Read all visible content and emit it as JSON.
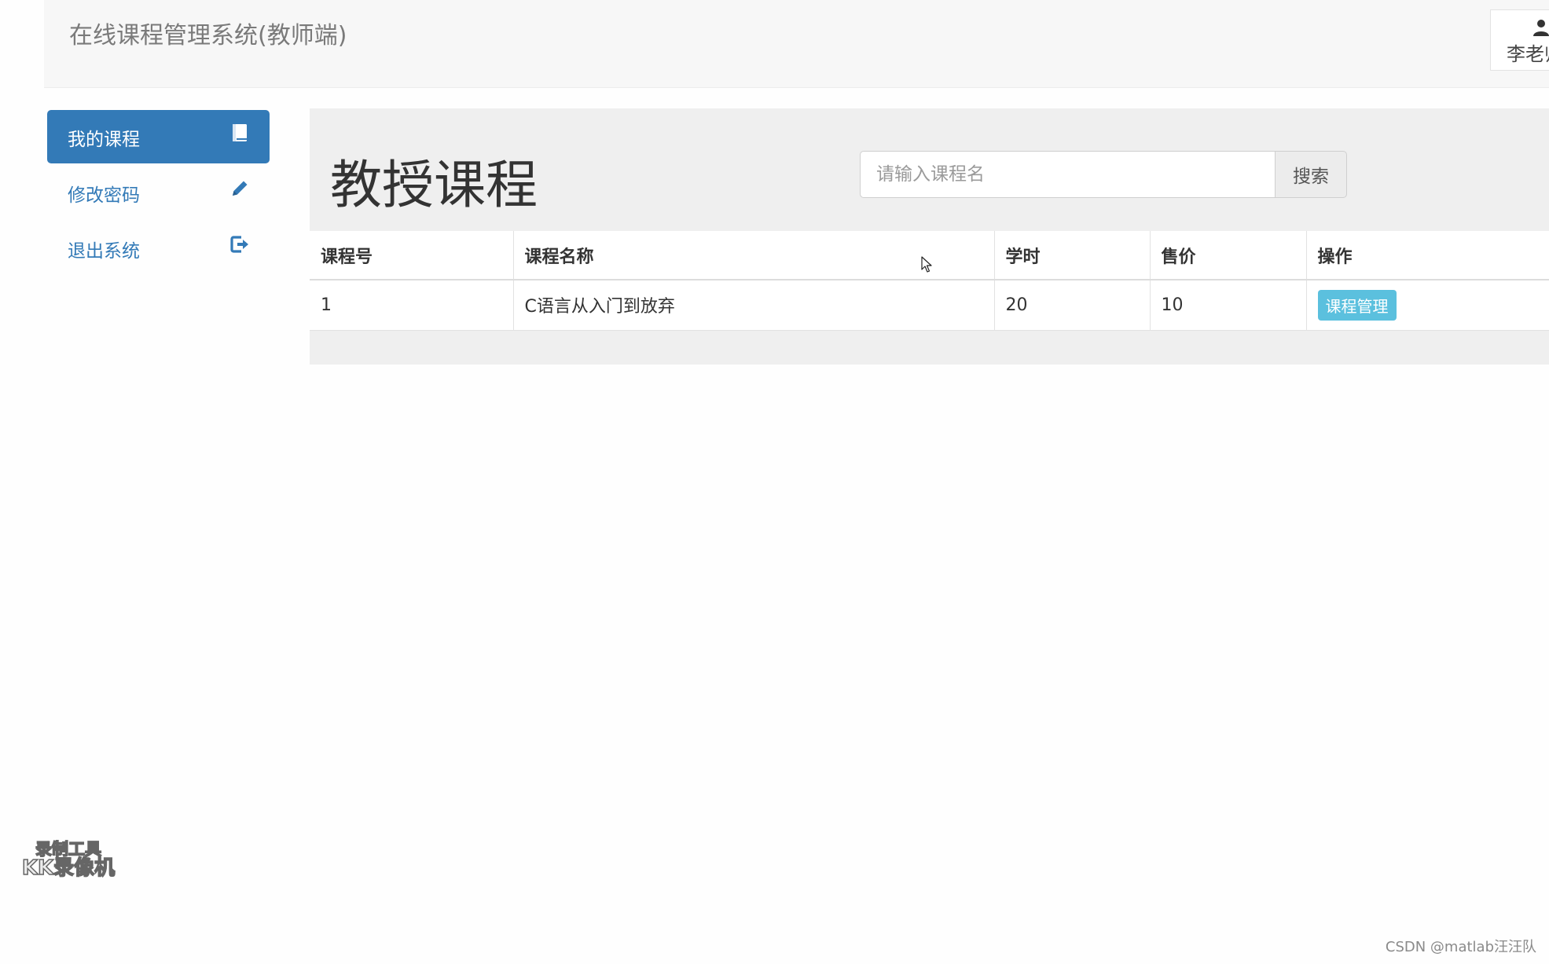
{
  "header": {
    "brand": "在线课程管理系统(教师端)",
    "user_name": "李老师"
  },
  "sidebar": {
    "items": [
      {
        "label": "我的课程",
        "icon": "book-icon",
        "active": true
      },
      {
        "label": "修改密码",
        "icon": "pencil-icon",
        "active": false
      },
      {
        "label": "退出系统",
        "icon": "logout-icon",
        "active": false
      }
    ]
  },
  "main": {
    "title": "教授课程",
    "search": {
      "placeholder": "请输入课程名",
      "value": "",
      "button_label": "搜索"
    },
    "table": {
      "columns": [
        "课程号",
        "课程名称",
        "学时",
        "售价",
        "操作"
      ],
      "rows": [
        {
          "id": "1",
          "name": "C语言从入门到放弃",
          "hours": "20",
          "price": "10",
          "action_label": "课程管理"
        }
      ]
    }
  },
  "overlay": {
    "watermark_line1": "录制工具",
    "watermark_line2": "KK录像机",
    "credit": "CSDN @matlab汪汪队"
  },
  "colors": {
    "primary": "#337ab7",
    "info_button": "#5bc0de",
    "panel_bg": "#efefef",
    "navbar_bg": "#f7f7f7"
  }
}
